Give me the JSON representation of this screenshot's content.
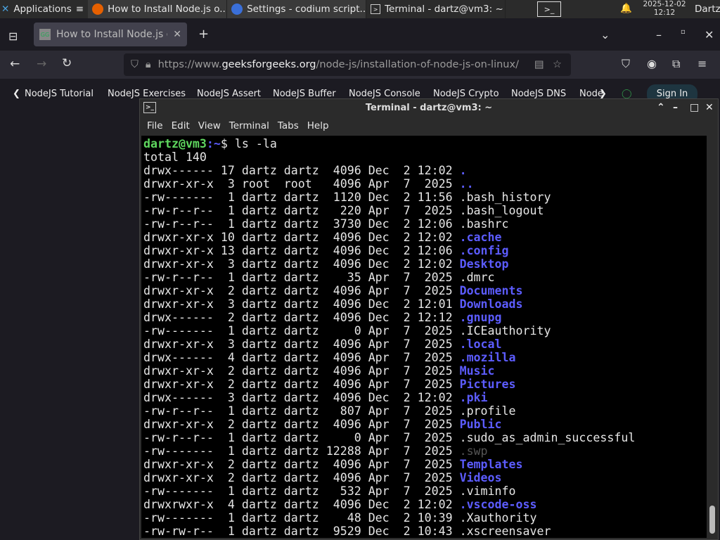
{
  "taskbar": {
    "apps_label": "Applications",
    "tasks": [
      "How to Install Node.js o...",
      "Settings - codium script...",
      "Terminal - dartz@vm3: ~"
    ],
    "date": "2025-12-02",
    "time": "12:12",
    "user": "Dartz"
  },
  "browser": {
    "tab_title": "How to Install Node.js or",
    "url_prefix": "https://www.",
    "url_domain": "geeksforgeeks.org",
    "url_path": "/node-js/installation-of-node-js-on-linux/",
    "bookmarks": [
      "NodeJS Tutorial",
      "NodeJS Exercises",
      "NodeJS Assert",
      "NodeJS Buffer",
      "NodeJS Console",
      "NodeJS Crypto",
      "NodeJS DNS",
      "Node"
    ],
    "sign_in": "Sign In"
  },
  "terminal": {
    "title": "Terminal - dartz@vm3: ~",
    "menu": [
      "File",
      "Edit",
      "View",
      "Terminal",
      "Tabs",
      "Help"
    ],
    "prompt_user": "dartz@vm3",
    "prompt_path": ":~",
    "prompt_sym": "$ ",
    "command": "ls -la",
    "total": "total 140",
    "rows": [
      {
        "info": "drwx------ 17 dartz dartz  4096 Dec  2 12:02 ",
        "name": ".",
        "kind": "dir"
      },
      {
        "info": "drwxr-xr-x  3 root  root   4096 Apr  7  2025 ",
        "name": "..",
        "kind": "dir"
      },
      {
        "info": "-rw-------  1 dartz dartz  1120 Dec  2 11:56 ",
        "name": ".bash_history",
        "kind": "file"
      },
      {
        "info": "-rw-r--r--  1 dartz dartz   220 Apr  7  2025 ",
        "name": ".bash_logout",
        "kind": "file"
      },
      {
        "info": "-rw-r--r--  1 dartz dartz  3730 Dec  2 12:06 ",
        "name": ".bashrc",
        "kind": "file"
      },
      {
        "info": "drwxr-xr-x 10 dartz dartz  4096 Dec  2 12:02 ",
        "name": ".cache",
        "kind": "dir"
      },
      {
        "info": "drwxr-xr-x 13 dartz dartz  4096 Dec  2 12:06 ",
        "name": ".config",
        "kind": "dir"
      },
      {
        "info": "drwxr-xr-x  3 dartz dartz  4096 Dec  2 12:02 ",
        "name": "Desktop",
        "kind": "dir"
      },
      {
        "info": "-rw-r--r--  1 dartz dartz    35 Apr  7  2025 ",
        "name": ".dmrc",
        "kind": "file"
      },
      {
        "info": "drwxr-xr-x  2 dartz dartz  4096 Apr  7  2025 ",
        "name": "Documents",
        "kind": "dir"
      },
      {
        "info": "drwxr-xr-x  3 dartz dartz  4096 Dec  2 12:01 ",
        "name": "Downloads",
        "kind": "dir"
      },
      {
        "info": "drwx------  2 dartz dartz  4096 Dec  2 12:12 ",
        "name": ".gnupg",
        "kind": "dir"
      },
      {
        "info": "-rw-------  1 dartz dartz     0 Apr  7  2025 ",
        "name": ".ICEauthority",
        "kind": "file"
      },
      {
        "info": "drwxr-xr-x  3 dartz dartz  4096 Apr  7  2025 ",
        "name": ".local",
        "kind": "dir"
      },
      {
        "info": "drwx------  4 dartz dartz  4096 Apr  7  2025 ",
        "name": ".mozilla",
        "kind": "dir"
      },
      {
        "info": "drwxr-xr-x  2 dartz dartz  4096 Apr  7  2025 ",
        "name": "Music",
        "kind": "dir"
      },
      {
        "info": "drwxr-xr-x  2 dartz dartz  4096 Apr  7  2025 ",
        "name": "Pictures",
        "kind": "dir"
      },
      {
        "info": "drwx------  3 dartz dartz  4096 Dec  2 12:02 ",
        "name": ".pki",
        "kind": "dir"
      },
      {
        "info": "-rw-r--r--  1 dartz dartz   807 Apr  7  2025 ",
        "name": ".profile",
        "kind": "file"
      },
      {
        "info": "drwxr-xr-x  2 dartz dartz  4096 Apr  7  2025 ",
        "name": "Public",
        "kind": "dir"
      },
      {
        "info": "-rw-r--r--  1 dartz dartz     0 Apr  7  2025 ",
        "name": ".sudo_as_admin_successful",
        "kind": "file"
      },
      {
        "info": "-rw-------  1 dartz dartz 12288 Apr  7  2025 ",
        "name": ".swp",
        "kind": "dim"
      },
      {
        "info": "drwxr-xr-x  2 dartz dartz  4096 Apr  7  2025 ",
        "name": "Templates",
        "kind": "dir"
      },
      {
        "info": "drwxr-xr-x  2 dartz dartz  4096 Apr  7  2025 ",
        "name": "Videos",
        "kind": "dir"
      },
      {
        "info": "-rw-------  1 dartz dartz   532 Apr  7  2025 ",
        "name": ".viminfo",
        "kind": "file"
      },
      {
        "info": "drwxrwxr-x  4 dartz dartz  4096 Dec  2 12:02 ",
        "name": ".vscode-oss",
        "kind": "dir"
      },
      {
        "info": "-rw-------  1 dartz dartz    48 Dec  2 10:39 ",
        "name": ".Xauthority",
        "kind": "file"
      },
      {
        "info": "-rw-rw-r--  1 dartz dartz  9529 Dec  2 10:43 ",
        "name": ".xscreensaver",
        "kind": "file"
      }
    ]
  },
  "colors": {
    "prompt": "#5fd75f",
    "directory": "#5c5cff",
    "dimmed": "#555555",
    "terminal_bg": "#000000"
  }
}
